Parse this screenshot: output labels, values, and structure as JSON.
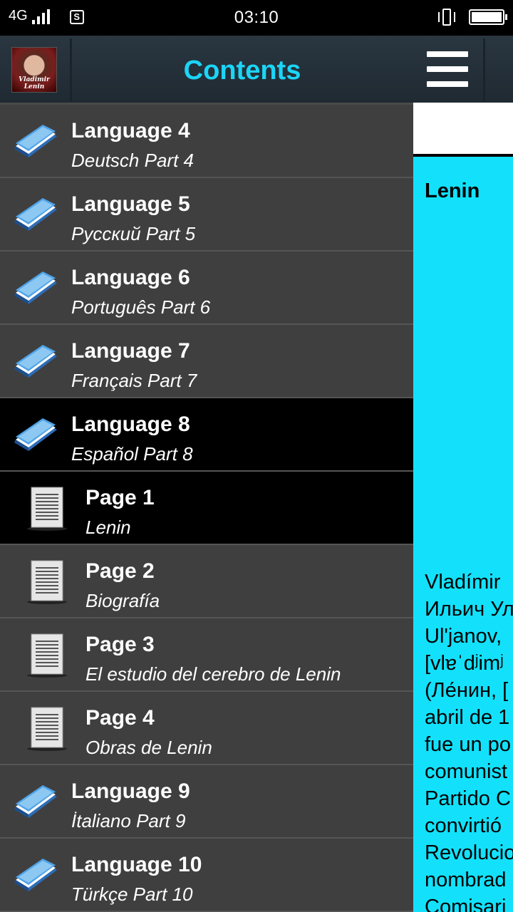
{
  "status_bar": {
    "network": "4G",
    "time": "03:10"
  },
  "drawer": {
    "title": "Contents",
    "avatar_caption_line1": "Vladimir",
    "avatar_caption_line2": "Lenin",
    "items": [
      {
        "type": "book",
        "title": "Language 4",
        "subtitle": "Deutsch Part 4",
        "active": false
      },
      {
        "type": "book",
        "title": "Language 5",
        "subtitle": "Русский Part 5",
        "active": false
      },
      {
        "type": "book",
        "title": "Language 6",
        "subtitle": "Português Part 6",
        "active": false
      },
      {
        "type": "book",
        "title": "Language 7",
        "subtitle": "Français Part 7",
        "active": false
      },
      {
        "type": "book",
        "title": "Language 8",
        "subtitle": "Español Part 8",
        "active": true
      },
      {
        "type": "page",
        "title": "Page 1",
        "subtitle": "Lenin",
        "active": true
      },
      {
        "type": "page",
        "title": "Page 2",
        "subtitle": "Biografía",
        "active": false
      },
      {
        "type": "page",
        "title": "Page 3",
        "subtitle": "El estudio del cerebro de Lenin",
        "active": false
      },
      {
        "type": "page",
        "title": "Page 4",
        "subtitle": "Obras de Lenin",
        "active": false
      },
      {
        "type": "book",
        "title": "Language 9",
        "subtitle": "İtaliano Part 9",
        "active": false
      },
      {
        "type": "book",
        "title": "Language 10",
        "subtitle": "Türkçe Part 10",
        "active": false
      }
    ]
  },
  "content": {
    "title": "Lenin",
    "body_lines": [
      "Vladímir",
      "Ильич Ул",
      "Ul'janov,",
      "[vlɐˈdʲimʲ",
      "(Ле́нин, [",
      "abril de 1",
      "fue un po",
      "comunist",
      "Partido C",
      "convirtió",
      "Revolucio",
      "nombrad",
      "Comisari"
    ]
  },
  "colors": {
    "accent": "#1cd4f6",
    "content_bg": "#13e1fc",
    "drawer_bg": "#3f3f3f",
    "active_bg": "#000000"
  }
}
